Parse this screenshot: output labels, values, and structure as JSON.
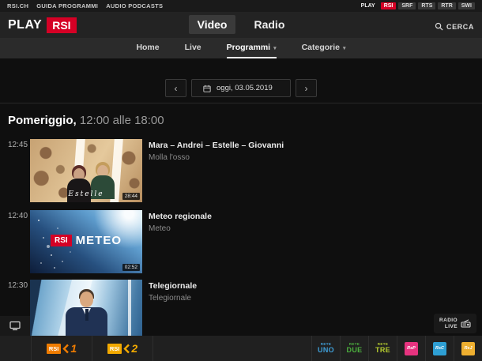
{
  "topbar": {
    "links": [
      {
        "label": "RSI.CH"
      },
      {
        "label": "GUIDA PROGRAMMI"
      },
      {
        "label": "AUDIO PODCASTS"
      }
    ],
    "portals": [
      {
        "label": "PLAY"
      },
      {
        "label": "RSI"
      },
      {
        "label": "SRF"
      },
      {
        "label": "RTS"
      },
      {
        "label": "RTR"
      },
      {
        "label": "SWI"
      }
    ]
  },
  "header": {
    "logo_play": "PLAY",
    "logo_rsi": "RSI",
    "tabs": [
      {
        "label": "Video"
      },
      {
        "label": "Radio"
      }
    ],
    "search_label": "CERCA"
  },
  "nav": {
    "items": [
      {
        "label": "Home"
      },
      {
        "label": "Live"
      },
      {
        "label": "Programmi"
      },
      {
        "label": "Categorie"
      }
    ],
    "caret": "▾"
  },
  "datepicker": {
    "prev": "‹",
    "next": "›",
    "value": "oggi, 03.05.2019"
  },
  "section": {
    "title": "Pomeriggio,",
    "range": "12:00 alle 18:00"
  },
  "programs": [
    {
      "time": "12:45",
      "title": "Mara – Andrei – Estelle – Giovanni",
      "subtitle": "Molla l'osso",
      "duration": "28:44",
      "overlay": "Estelle"
    },
    {
      "time": "12:40",
      "title": "Meteo regionale",
      "subtitle": "Meteo",
      "duration": "02:52",
      "logo_box": "RSI",
      "logo_text": "METEO"
    },
    {
      "time": "12:30",
      "title": "Telegiornale",
      "subtitle": "Telegiornale"
    }
  ],
  "radio_live": {
    "line1": "RADIO",
    "line2": "LIVE"
  },
  "channelbar": {
    "tv": [
      {
        "box": "RSI",
        "num": "1"
      },
      {
        "box": "RSI",
        "num": "2"
      }
    ],
    "radio": [
      {
        "line1": "RETE",
        "line2": "UNO"
      },
      {
        "line1": "RETE",
        "line2": "DUE"
      },
      {
        "line1": "RETE",
        "line2": "TRE"
      },
      {
        "glyph": "RsP"
      },
      {
        "glyph": "RsC"
      },
      {
        "glyph": "RsJ"
      }
    ]
  },
  "colors": {
    "rsi_red": "#d50025",
    "la1_orange": "#ef7c00",
    "la2_yellow": "#f2a900",
    "rete_uno_blue": "#3f9fd8",
    "rete_due_green": "#4caf3e",
    "rete_tre_lime": "#b5cc2e",
    "swiss_pop_pink": "#e6337f",
    "swiss_classic_blue": "#2e9fd4",
    "swiss_jazz_yellow": "#eeaf30"
  }
}
